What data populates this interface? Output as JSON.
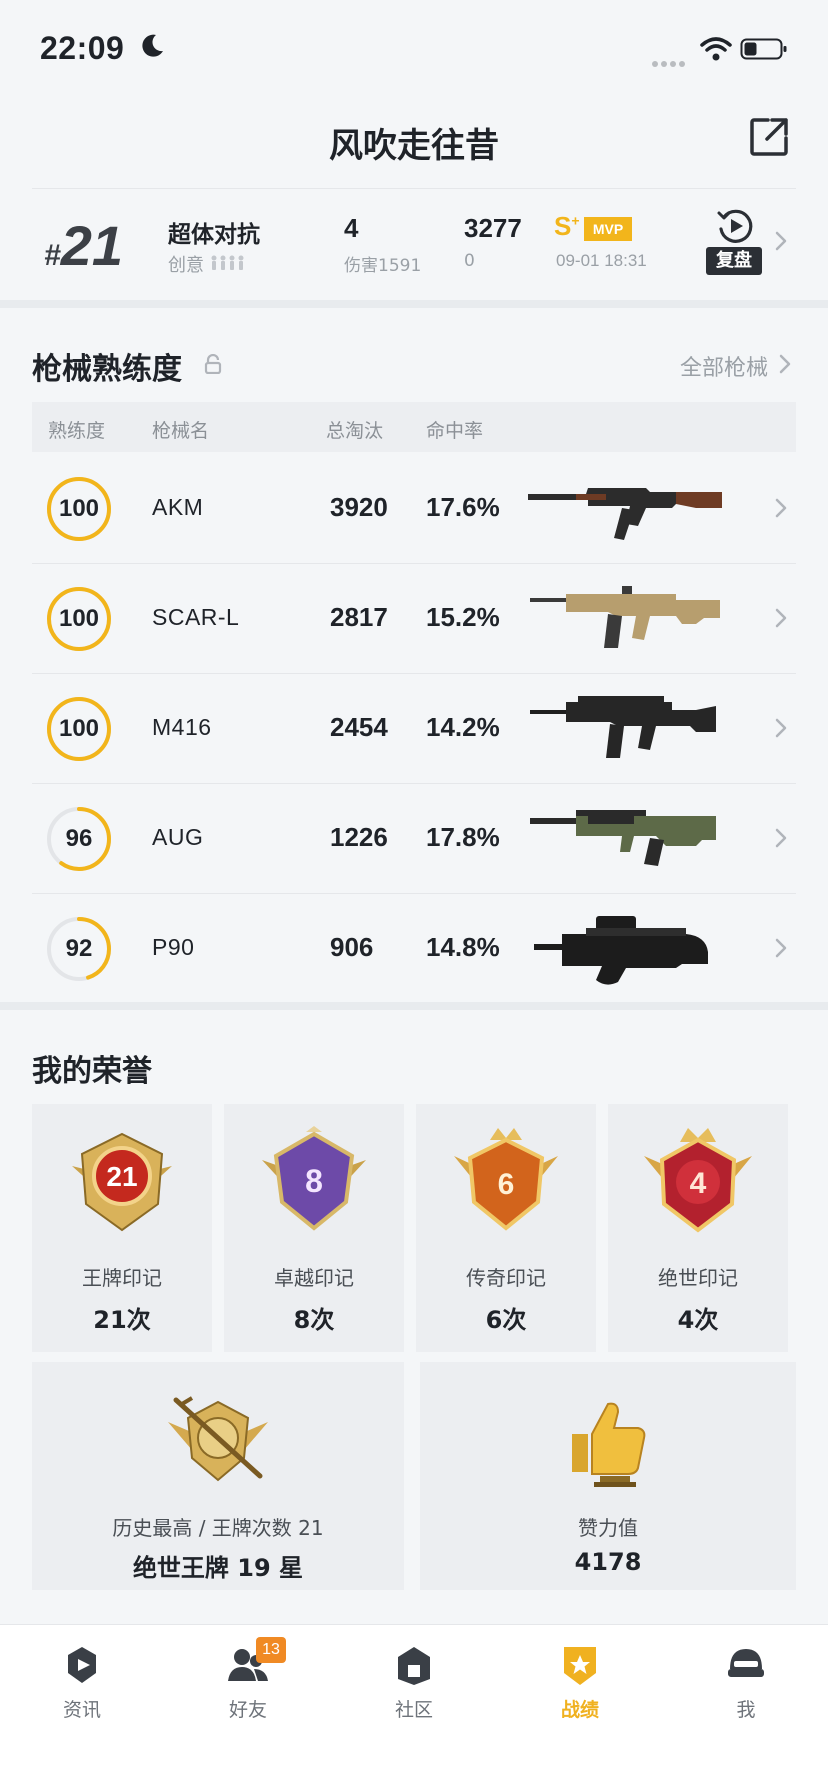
{
  "status_bar": {
    "time": "22:09"
  },
  "header": {
    "title": "风吹走往昔"
  },
  "match": {
    "rank": "21",
    "mode": "超体对抗",
    "mode_sub": "创意",
    "kills": "4",
    "damage": "伤害1591",
    "score": "3277",
    "score_sub": "0",
    "grade": "S",
    "grade_plus": "+",
    "mvp": "MVP",
    "time": "09-01 18:31",
    "replay_label": "复盘"
  },
  "weapons": {
    "title": "枪械熟练度",
    "all_link": "全部枪械",
    "columns": {
      "mastery": "熟练度",
      "name": "枪械名",
      "kills": "总淘汰",
      "accuracy": "命中率"
    },
    "items": [
      {
        "mastery": "100",
        "mastery_pct": 100,
        "name": "AKM",
        "kills": "3920",
        "accuracy": "17.6%",
        "icon": "akm-rifle"
      },
      {
        "mastery": "100",
        "mastery_pct": 100,
        "name": "SCAR-L",
        "kills": "2817",
        "accuracy": "15.2%",
        "icon": "scar-rifle"
      },
      {
        "mastery": "100",
        "mastery_pct": 100,
        "name": "M416",
        "kills": "2454",
        "accuracy": "14.2%",
        "icon": "m416-rifle"
      },
      {
        "mastery": "96",
        "mastery_pct": 60,
        "name": "AUG",
        "kills": "1226",
        "accuracy": "17.8%",
        "icon": "aug-rifle"
      },
      {
        "mastery": "92",
        "mastery_pct": 45,
        "name": "P90",
        "kills": "906",
        "accuracy": "14.8%",
        "icon": "p90-smg"
      }
    ]
  },
  "honors": {
    "title": "我的荣誉",
    "items": [
      {
        "badge_num": "21",
        "label": "王牌印记",
        "count": "21次",
        "color": "#c4291e"
      },
      {
        "badge_num": "8",
        "label": "卓越印记",
        "count": "8次",
        "color": "#6d4aa8"
      },
      {
        "badge_num": "6",
        "label": "传奇印记",
        "count": "6次",
        "color": "#d2641c"
      },
      {
        "badge_num": "4",
        "label": "绝世印记",
        "count": "4次",
        "color": "#b3212e"
      }
    ],
    "best": {
      "label": "历史最高 / 王牌次数 21",
      "value": "绝世王牌 19 星"
    },
    "likes": {
      "label": "赞力值",
      "value": "4178"
    }
  },
  "nav": {
    "items": [
      {
        "label": "资讯",
        "icon": "news-icon"
      },
      {
        "label": "好友",
        "icon": "friends-icon",
        "badge": "13"
      },
      {
        "label": "社区",
        "icon": "community-icon"
      },
      {
        "label": "战绩",
        "icon": "record-icon",
        "active": true
      },
      {
        "label": "我",
        "icon": "profile-icon"
      }
    ]
  },
  "colors": {
    "accent": "#f2b51b",
    "ring_track": "#e3e5e8"
  }
}
